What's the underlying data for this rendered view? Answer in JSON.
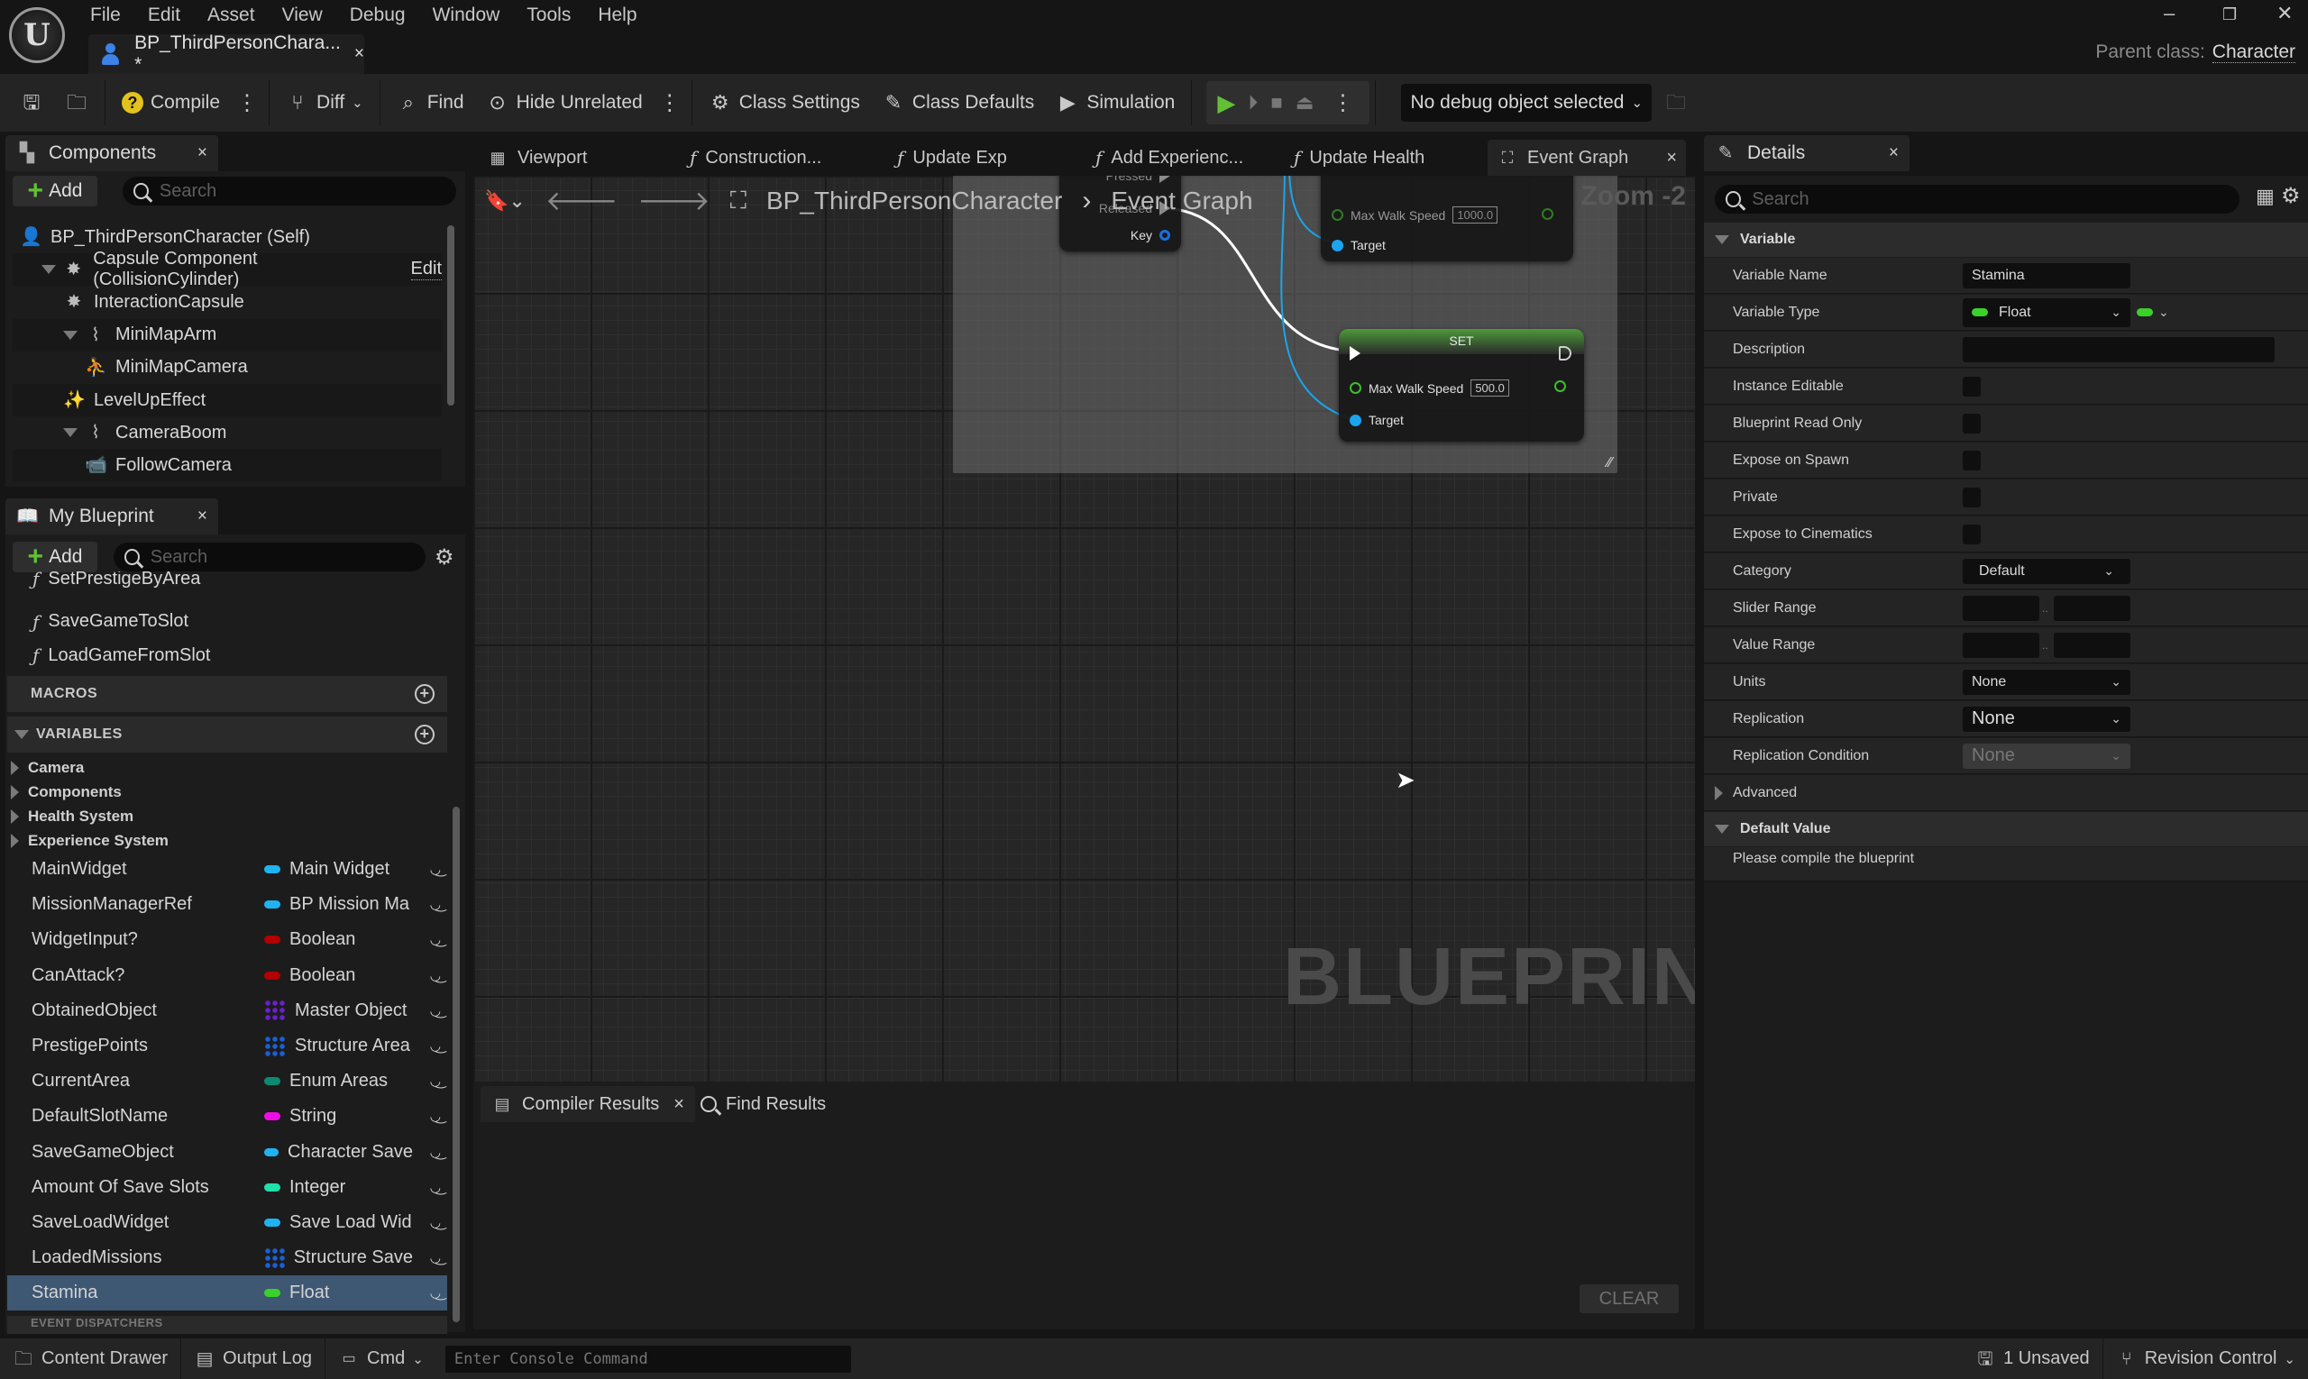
{
  "app": {
    "menu": [
      "File",
      "Edit",
      "Asset",
      "View",
      "Debug",
      "Window",
      "Tools",
      "Help"
    ],
    "document_tab": "BP_ThirdPersonChara... *",
    "parent_class_label": "Parent class:",
    "parent_class_value": "Character"
  },
  "toolbar": {
    "compile": "Compile",
    "diff": "Diff",
    "find": "Find",
    "hide_unrelated": "Hide Unrelated",
    "class_settings": "Class Settings",
    "class_defaults": "Class Defaults",
    "simulation": "Simulation",
    "debug_object": "No debug object selected"
  },
  "components": {
    "tab_label": "Components",
    "add_label": "Add",
    "search_placeholder": "Search",
    "tree": [
      {
        "label": "BP_ThirdPersonCharacter (Self)",
        "indent": 0,
        "icon": "pawn-icon"
      },
      {
        "label": "Capsule Component (CollisionCylinder)",
        "indent": 1,
        "icon": "capsule-icon",
        "expanded": true,
        "edit_link": "Edit"
      },
      {
        "label": "InteractionCapsule",
        "indent": 2,
        "icon": "capsule-icon"
      },
      {
        "label": "MiniMapArm",
        "indent": 2,
        "icon": "spring-arm-icon",
        "expanded": true
      },
      {
        "label": "MiniMapCamera",
        "indent": 3,
        "icon": "scene-capture-icon"
      },
      {
        "label": "LevelUpEffect",
        "indent": 2,
        "icon": "particles-icon"
      },
      {
        "label": "CameraBoom",
        "indent": 2,
        "icon": "spring-arm-icon",
        "expanded": true
      },
      {
        "label": "FollowCamera",
        "indent": 3,
        "icon": "camera-icon"
      }
    ]
  },
  "my_blueprint": {
    "tab_label": "My Blueprint",
    "add_label": "Add",
    "search_placeholder": "Search",
    "functions": [
      "SetPrestigeByArea",
      "SaveGameToSlot",
      "LoadGameFromSlot"
    ],
    "macros_label": "MACROS",
    "variables_label": "VARIABLES",
    "event_dispatchers_label": "EVENT DISPATCHERS",
    "categories": [
      "Camera",
      "Components",
      "Health System",
      "Experience System"
    ],
    "variables": [
      {
        "name": "MainWidget",
        "type": "Main Widget",
        "color": "#1fb3f2",
        "shape": "pill"
      },
      {
        "name": "MissionManagerRef",
        "type": "BP Mission Ma",
        "color": "#1fb3f2",
        "shape": "pill"
      },
      {
        "name": "WidgetInput?",
        "type": "Boolean",
        "color": "#b30000",
        "shape": "pill"
      },
      {
        "name": "CanAttack?",
        "type": "Boolean",
        "color": "#b30000",
        "shape": "pill"
      },
      {
        "name": "ObtainedObject",
        "type": "Master Object",
        "color": "#6a1fd0",
        "shape": "grid"
      },
      {
        "name": "PrestigePoints",
        "type": "Structure Area",
        "color": "#1a5fd6",
        "shape": "grid"
      },
      {
        "name": "CurrentArea",
        "type": "Enum Areas",
        "color": "#0d8a72",
        "shape": "pill"
      },
      {
        "name": "DefaultSlotName",
        "type": "String",
        "color": "#f00ce6",
        "shape": "pill"
      },
      {
        "name": "SaveGameObject",
        "type": "Character Save",
        "color": "#1fb3f2",
        "shape": "pill"
      },
      {
        "name": "Amount Of Save Slots",
        "type": "Integer",
        "color": "#1fe0a8",
        "shape": "pill"
      },
      {
        "name": "SaveLoadWidget",
        "type": "Save Load Wid",
        "color": "#1fb3f2",
        "shape": "pill"
      },
      {
        "name": "LoadedMissions",
        "type": "Structure Save",
        "color": "#1a5fd6",
        "shape": "grid"
      },
      {
        "name": "Stamina",
        "type": "Float",
        "color": "#3ad12a",
        "shape": "pill",
        "selected": true
      }
    ]
  },
  "editor_tabs": [
    {
      "label": "Viewport",
      "icon": "viewport-icon"
    },
    {
      "label": "Construction...",
      "icon": "function-icon"
    },
    {
      "label": "Update Exp",
      "icon": "function-icon"
    },
    {
      "label": "Add Experienc...",
      "icon": "function-icon"
    },
    {
      "label": "Update Health",
      "icon": "function-icon"
    },
    {
      "label": "Event Graph",
      "icon": "event-graph-icon",
      "active": true
    }
  ],
  "graph": {
    "breadcrumb_root": "BP_ThirdPersonCharacter",
    "breadcrumb_current": "Event Graph",
    "zoom_label": "Zoom -2",
    "watermark": "BLUEPRINT",
    "input_node": {
      "pins": [
        "Pressed",
        "Released",
        "Key"
      ]
    },
    "set_node_top": {
      "pin_label": "Max Walk Speed",
      "value": "1000.0",
      "target_label": "Target"
    },
    "set_node": {
      "title": "SET",
      "pin_label": "Max Walk Speed",
      "value": "500.0",
      "target_label": "Target"
    }
  },
  "bottom_tabs": {
    "compiler_results": "Compiler Results",
    "find_results": "Find Results",
    "clear": "CLEAR"
  },
  "details": {
    "tab_label": "Details",
    "search_placeholder": "Search",
    "variable_section": "Variable",
    "rows": {
      "variable_name": {
        "label": "Variable Name",
        "value": "Stamina"
      },
      "variable_type": {
        "label": "Variable Type",
        "value": "Float",
        "color": "#3ad12a"
      },
      "description": {
        "label": "Description",
        "value": ""
      },
      "instance_editable": {
        "label": "Instance Editable",
        "checked": false
      },
      "blueprint_read_only": {
        "label": "Blueprint Read Only",
        "checked": false
      },
      "expose_on_spawn": {
        "label": "Expose on Spawn",
        "checked": false
      },
      "private": {
        "label": "Private",
        "checked": false
      },
      "expose_to_cinematics": {
        "label": "Expose to Cinematics",
        "checked": false
      },
      "category": {
        "label": "Category",
        "value": "Default"
      },
      "slider_range": {
        "label": "Slider Range",
        "min": "",
        "max": ""
      },
      "value_range": {
        "label": "Value Range",
        "min": "",
        "max": ""
      },
      "units": {
        "label": "Units",
        "value": "None"
      },
      "replication": {
        "label": "Replication",
        "value": "None"
      },
      "replication_condition": {
        "label": "Replication Condition",
        "value": "None"
      }
    },
    "advanced_label": "Advanced",
    "default_value_section": "Default Value",
    "default_value_message": "Please compile the blueprint"
  },
  "statusbar": {
    "content_drawer": "Content Drawer",
    "output_log": "Output Log",
    "cmd": "Cmd",
    "console_placeholder": "Enter Console Command",
    "unsaved": "1 Unsaved",
    "revision_control": "Revision Control"
  }
}
